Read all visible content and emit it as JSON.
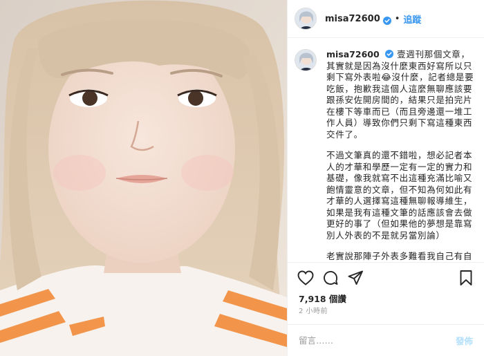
{
  "header": {
    "username": "misa72600",
    "separator": "•",
    "follow_label": "追蹤"
  },
  "caption": {
    "username": "misa72600",
    "paragraphs": [
      "壹週刊那個文章，其實就是因為沒什麼東西好寫所以只剩下寫外表啦😂沒什麼，記者總是要吃飯，抱歉我這個人這麼無聊應該要跟孫安佐開房間的，結果只是拍完片在樓下等車而已（而且旁邊還一堆工作人員）導致你們只剩下寫這種東西交件了。",
      "不過文筆真的還不錯啦，想必記者本人的才華和學歷一定有一定的實力和基礎，像我就寫不出這種充滿比喻又飽情靈意的文章，但不知為何如此有才華的人選擇寫這種無聊報導維生，如果是我有這種文筆的話應該會去做更好的事了（但如果他的夢想是靠寫別人外表的不是就另當別論）",
      "老實說那陣子外表多難看我自己有自知之明，畢竟就像她說工作的原因"
    ]
  },
  "stats": {
    "views": "7,918",
    "views_suffix": "個讚",
    "time_ago": "2 小時前"
  },
  "comment_box": {
    "placeholder": "留言……",
    "post_label": "發佈"
  },
  "icons": {
    "like": "heart-icon",
    "comment": "comment-icon",
    "share": "share-icon",
    "save": "bookmark-icon",
    "verified": "verified-badge-icon"
  },
  "colors": {
    "accent": "#3897f0",
    "post_disabled": "#b2dffc",
    "stripe": "#f28c3a"
  }
}
